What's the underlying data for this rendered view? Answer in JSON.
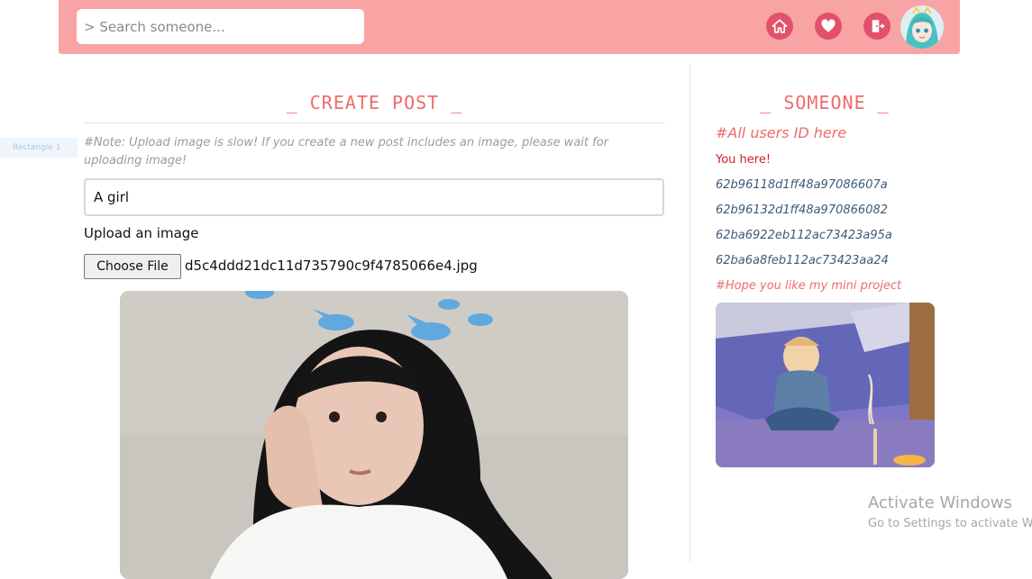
{
  "header": {
    "search_placeholder": "> Search someone...",
    "nav": [
      {
        "name": "home-icon"
      },
      {
        "name": "heart-icon"
      },
      {
        "name": "logout-icon"
      }
    ],
    "avatar_icon": "anime-avatar"
  },
  "ghost_tag_text": "Rectangle 1",
  "create_post": {
    "title": "_ CREATE POST _",
    "note": "#Note: Upload image is slow! If you create a new post includes an image, please wait for uploading image!",
    "caption_value": "A girl",
    "upload_label": "Upload an image",
    "choose_file_label": "Choose File",
    "file_name": "d5c4ddd21dc11d735790c9f4785066e4.jpg"
  },
  "sidebar": {
    "title": "_ SOMEONE _",
    "users_heading": "#All users ID here",
    "you_here": "You here!",
    "user_ids": [
      "62b96118d1ff48a97086607a",
      "62b96132d1ff48a970866082",
      "62ba6922eb112ac73423a95a",
      "62ba6a8feb112ac73423aa24"
    ],
    "hope_text": "#Hope you like my mini project"
  },
  "watermark": {
    "line1": "Activate Windows",
    "line2": "Go to Settings to activate Windows."
  },
  "colors": {
    "header_bg": "#f9a4a4",
    "accent": "#ef6a6a",
    "icon_bg": "#e3506a"
  }
}
